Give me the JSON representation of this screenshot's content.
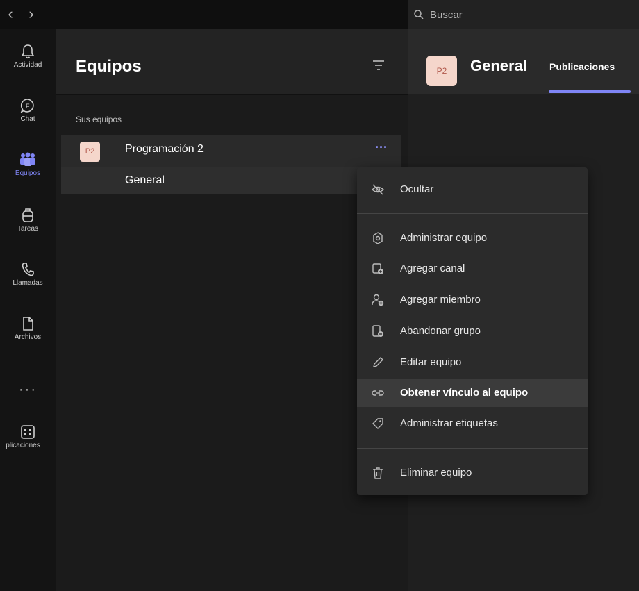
{
  "nav": {
    "back_glyph": "‹",
    "forward_glyph": "›"
  },
  "search": {
    "placeholder": "Buscar"
  },
  "rail": {
    "items": [
      {
        "label": "Actividad",
        "icon": "bell-icon"
      },
      {
        "label": "Chat",
        "icon": "chat-icon"
      },
      {
        "label": "Equipos",
        "icon": "teams-icon",
        "active": true
      },
      {
        "label": "Tareas",
        "icon": "backpack-icon"
      },
      {
        "label": "Llamadas",
        "icon": "phone-icon"
      },
      {
        "label": "Archivos",
        "icon": "file-icon"
      }
    ],
    "more": "···",
    "apps_label": "plicaciones"
  },
  "panel": {
    "title": "Equipos",
    "section_label": "Sus equipos",
    "team": {
      "avatar": "P2",
      "name": "Programación 2",
      "more": "···"
    },
    "channel": {
      "name": "General"
    }
  },
  "main": {
    "avatar": "P2",
    "title": "General",
    "tab": "Publicaciones"
  },
  "menu": {
    "items": [
      {
        "label": "Ocultar",
        "icon": "eye-off-icon"
      },
      {
        "label": "Administrar equipo",
        "icon": "settings-icon"
      },
      {
        "label": "Agregar canal",
        "icon": "add-channel-icon"
      },
      {
        "label": "Agregar miembro",
        "icon": "add-member-icon"
      },
      {
        "label": "Abandonar grupo",
        "icon": "leave-icon"
      },
      {
        "label": "Editar equipo",
        "icon": "pencil-icon"
      },
      {
        "label": "Obtener vínculo al equipo",
        "icon": "link-icon",
        "highlighted": true
      },
      {
        "label": "Administrar etiquetas",
        "icon": "tag-icon"
      },
      {
        "label": "Eliminar equipo",
        "icon": "trash-icon"
      }
    ]
  },
  "colors": {
    "accent": "#7f85f5",
    "avatar_bg": "#f5d6cb",
    "avatar_text": "#b0574a"
  }
}
